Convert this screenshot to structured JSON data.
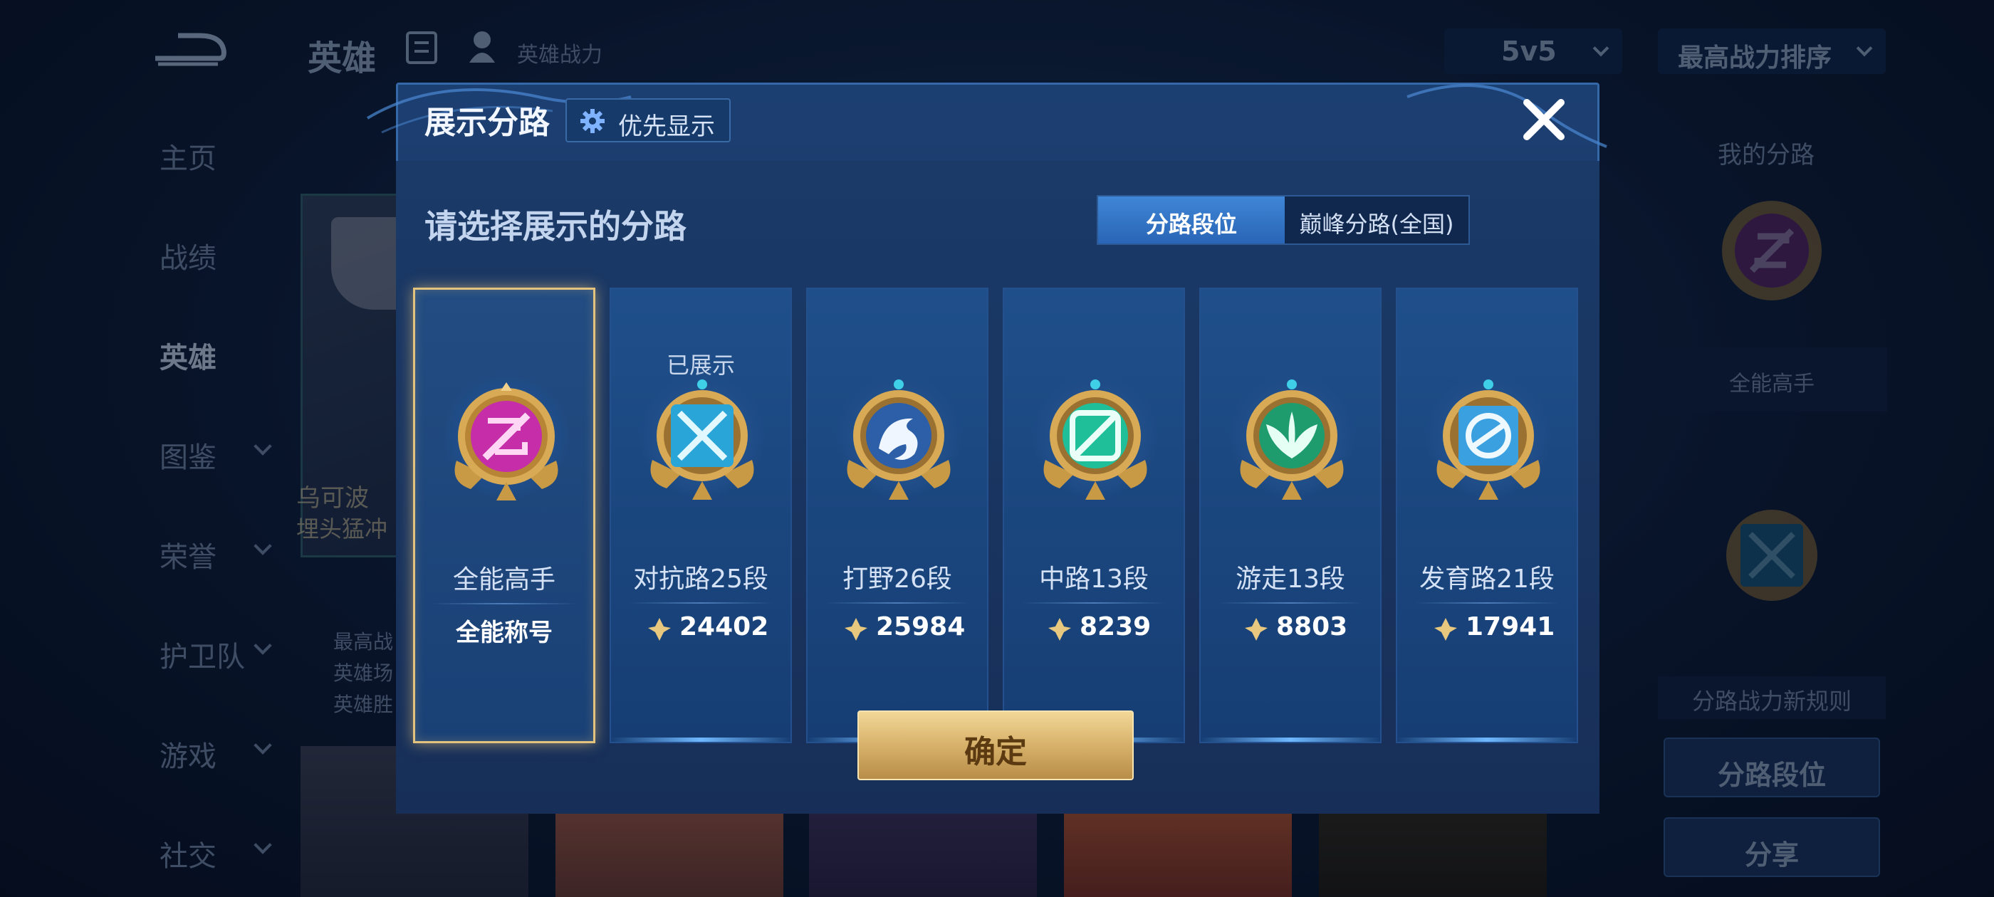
{
  "header": {
    "title": "英雄",
    "subtitle": "英雄战力",
    "mode_select": "5v5",
    "sort_select": "最高战力排序"
  },
  "nav": {
    "items": [
      {
        "label": "主页"
      },
      {
        "label": "战绩"
      },
      {
        "label": "英雄"
      },
      {
        "label": "图鉴"
      },
      {
        "label": "荣誉"
      },
      {
        "label": "护卫队"
      },
      {
        "label": "游戏"
      },
      {
        "label": "社交"
      }
    ]
  },
  "hero_card": {
    "name": "乌可波",
    "desc": "埋头猛冲",
    "stats": [
      "最高战",
      "英雄场",
      "英雄胜"
    ]
  },
  "right_panel": {
    "title": "我的分路",
    "current_title": "全能高手",
    "rule_text": "分路战力新规则",
    "lane_rank_button": "分路段位",
    "share_button": "分享"
  },
  "modal": {
    "title": "展示分路",
    "priority_button": "优先显示",
    "subtitle": "请选择展示的分路",
    "tabs": [
      {
        "label": "分路段位",
        "active": true
      },
      {
        "label": "巅峰分路(全国)",
        "active": false
      }
    ],
    "lanes": [
      {
        "name": "全能高手",
        "title": "全能称号",
        "status": "",
        "selected": true,
        "icon": "all-round-badge-icon"
      },
      {
        "name": "对抗路25段",
        "score": "24402",
        "status": "已展示",
        "selected": false,
        "icon": "clash-lane-badge-icon"
      },
      {
        "name": "打野26段",
        "score": "25984",
        "status": "",
        "selected": false,
        "icon": "jungle-badge-icon"
      },
      {
        "name": "中路13段",
        "score": "8239",
        "status": "",
        "selected": false,
        "icon": "mid-lane-badge-icon"
      },
      {
        "name": "游走13段",
        "score": "8803",
        "status": "",
        "selected": false,
        "icon": "roam-badge-icon"
      },
      {
        "name": "发育路21段",
        "score": "17941",
        "status": "",
        "selected": false,
        "icon": "farm-lane-badge-icon"
      }
    ],
    "confirm_button": "确定"
  },
  "colors": {
    "accent_gold": "#e2c27c",
    "tab_active": "#3f86d6",
    "all_round": "#c02aa8",
    "clash": "#2aa5d8",
    "jungle": "#2c5fa8",
    "mid": "#1fbf9a",
    "roam": "#1f9c6e",
    "farm": "#3aa0e0"
  }
}
